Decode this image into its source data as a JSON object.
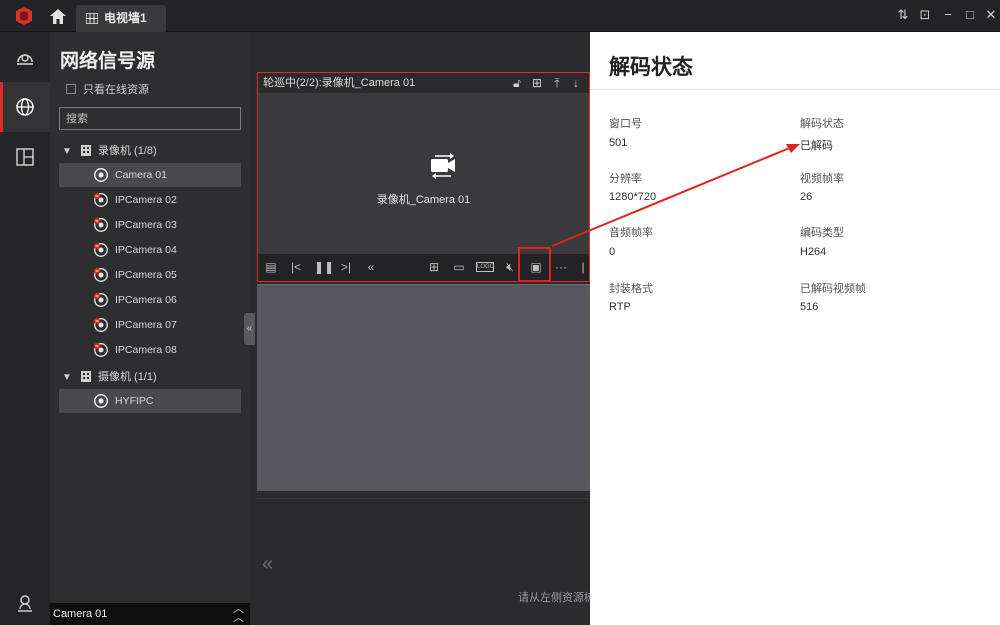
{
  "titlebar": {
    "tab_label": "电视墙1"
  },
  "panel": {
    "title": "网络信号源",
    "online_only_label": "只看在线资源",
    "search_placeholder": "搜索",
    "groups": [
      {
        "label": "录像机 (1/8)"
      },
      {
        "label": "摄像机 (1/1)"
      }
    ],
    "recorder_items": [
      "Camera 01",
      "IPCamera 02",
      "IPCamera 03",
      "IPCamera 04",
      "IPCamera 05",
      "IPCamera 06",
      "IPCamera 07",
      "IPCamera 08"
    ],
    "camera_items": [
      "HYFIPC"
    ],
    "bottom_label": "Camera 01"
  },
  "main": {
    "window_title": "轮巡中(2/2):录像机_Camera 01",
    "video_label": "录像机_Camera 01",
    "hint": "请从左侧资源树"
  },
  "status": {
    "title": "解码状态",
    "fields": [
      {
        "label": "窗口号",
        "value": "501"
      },
      {
        "label": "解码状态",
        "value": "已解码"
      },
      {
        "label": "分辨率",
        "value": "1280*720"
      },
      {
        "label": "视频帧率",
        "value": "26"
      },
      {
        "label": "音频帧率",
        "value": "0"
      },
      {
        "label": "编码类型",
        "value": "H264"
      },
      {
        "label": "封装格式",
        "value": "RTP"
      },
      {
        "label": "已解码视频帧",
        "value": "516"
      }
    ]
  },
  "colors": {
    "accent": "#e0251f"
  }
}
